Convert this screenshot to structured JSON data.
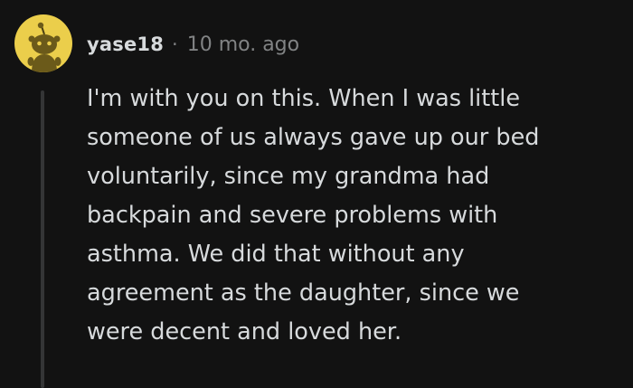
{
  "comment": {
    "author": "yase18",
    "separator": "·",
    "timestamp": "10 mo. ago",
    "avatar_icon": "reddit-snoo-avatar",
    "avatar_color": "#ebce4b",
    "body_lines": [
      "I'm with you on this. When I was little",
      "someone of us always gave up our bed",
      "voluntarily, since my grandma had",
      "backpain and severe problems with",
      "asthma. We did that without any",
      "agreement as the daughter, since we",
      "were decent and loved her."
    ]
  },
  "colors": {
    "background": "#121212",
    "text": "#d7dadc",
    "meta": "#818384",
    "thread_line": "#343536"
  }
}
